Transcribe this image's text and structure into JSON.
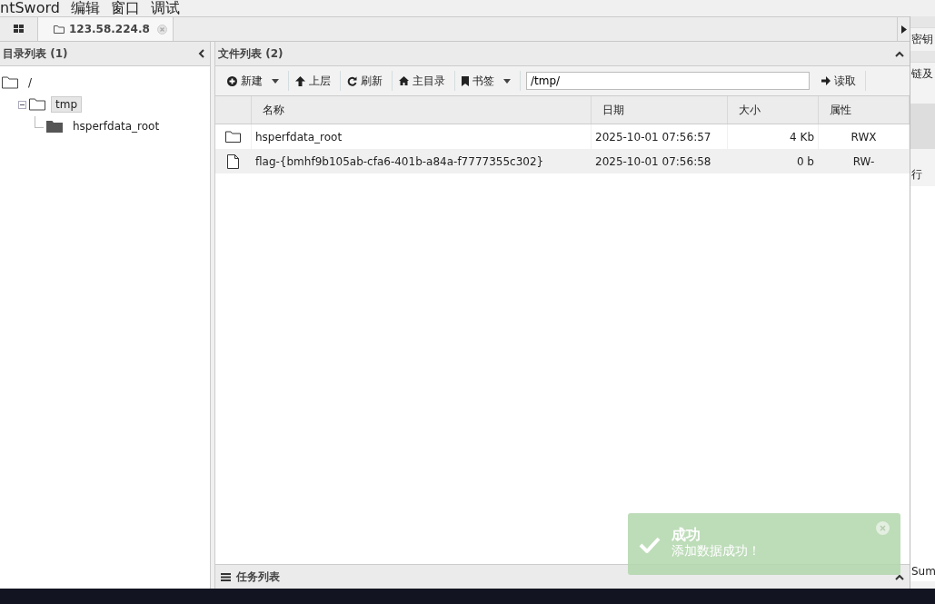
{
  "app_menu": [
    "ntSword",
    "编辑",
    "窗口",
    "调试"
  ],
  "tabs": [
    {
      "label": "123.58.224.8",
      "selected": true
    }
  ],
  "dir_panel": {
    "title": "目录列表 (1)",
    "tree": [
      {
        "label": "/",
        "selected": false,
        "children": [
          {
            "label": "tmp",
            "selected": true,
            "expanded": true,
            "children": [
              {
                "label": "hsperfdata_root",
                "selected": false
              }
            ]
          }
        ]
      }
    ]
  },
  "file_panel": {
    "title": "文件列表 (2)",
    "toolbar": [
      {
        "label": "新建",
        "has_menu": true
      },
      {
        "label": "上层",
        "has_menu": false
      },
      {
        "label": "刷新",
        "has_menu": false
      },
      {
        "label": "主目录",
        "has_menu": false
      },
      {
        "label": "书签",
        "has_menu": true
      }
    ],
    "path": {
      "value": "/tmp/"
    },
    "read_button": "读取",
    "columns": [
      "名称",
      "日期",
      "大小",
      "属性"
    ],
    "rows": [
      {
        "kind": "folder",
        "name": "hsperfdata_root",
        "date": "2025-10-01 07:56:57",
        "size": "4 Kb",
        "attrs": "RWX",
        "selected": false
      },
      {
        "kind": "file",
        "name": "flag-{bmhf9b105ab-cfa6-401b-a84a-f7777355c302}",
        "date": "2025-10-01 07:56:58",
        "size": "0 b",
        "attrs": "RW-",
        "selected": true
      }
    ]
  },
  "task_panel": {
    "title": "任务列表"
  },
  "side_texts": [
    "密钥",
    "链及",
    "行",
    "Sum"
  ],
  "toast": {
    "title": "成功",
    "message": "添加数据成功！"
  }
}
